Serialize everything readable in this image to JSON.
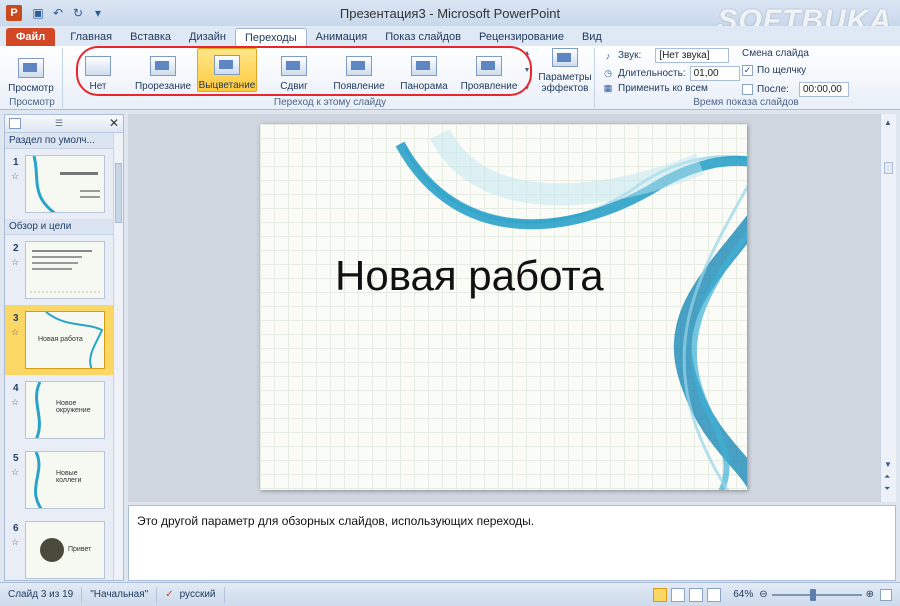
{
  "window": {
    "title": "Презентация3 - Microsoft PowerPoint",
    "watermark": "SOFTBUKA",
    "app_icon": "P"
  },
  "tabs": [
    "Файл",
    "Главная",
    "Вставка",
    "Дизайн",
    "Переходы",
    "Анимация",
    "Показ слайдов",
    "Рецензирование",
    "Вид"
  ],
  "active_tab": "Переходы",
  "ribbon": {
    "preview_label": "Просмотр",
    "preview_group": "Просмотр",
    "transitions": [
      {
        "label": "Нет",
        "selected": false
      },
      {
        "label": "Прорезание",
        "selected": false
      },
      {
        "label": "Выцветание",
        "selected": true
      },
      {
        "label": "Сдвиг",
        "selected": false
      },
      {
        "label": "Появление",
        "selected": false
      },
      {
        "label": "Панорама",
        "selected": false
      },
      {
        "label": "Проявление",
        "selected": false
      }
    ],
    "effects_label_1": "Параметры",
    "effects_label_2": "эффектов",
    "transition_group": "Переход к этому слайду",
    "sound_label": "Звук:",
    "sound_value": "[Нет звука]",
    "duration_label": "Длительность:",
    "duration_value": "01,00",
    "apply_all_label": "Применить ко всем",
    "advance_title": "Смена слайда",
    "on_click_label": "По щелчку",
    "on_click_checked": true,
    "after_label": "После:",
    "after_checked": false,
    "after_value": "00:00,00",
    "timing_group": "Время показа слайдов"
  },
  "slides_pane": {
    "sections": [
      "Раздел по умолч...",
      "Обзор и цели"
    ],
    "slides": [
      {
        "num": "1",
        "text": ""
      },
      {
        "num": "2",
        "text": ""
      },
      {
        "num": "3",
        "text": "Новая работа"
      },
      {
        "num": "4",
        "text": "Новое окружение"
      },
      {
        "num": "5",
        "text": "Новые коллеги"
      },
      {
        "num": "6",
        "text": "Привет"
      }
    ],
    "current_slide": 3
  },
  "slide": {
    "title": "Новая работа"
  },
  "notes": {
    "text": "Это другой параметр для обзорных слайдов, использующих переходы."
  },
  "status": {
    "slide_info": "Слайд 3 из 19",
    "theme": "\"Начальная\"",
    "language": "русский",
    "zoom": "64%"
  }
}
